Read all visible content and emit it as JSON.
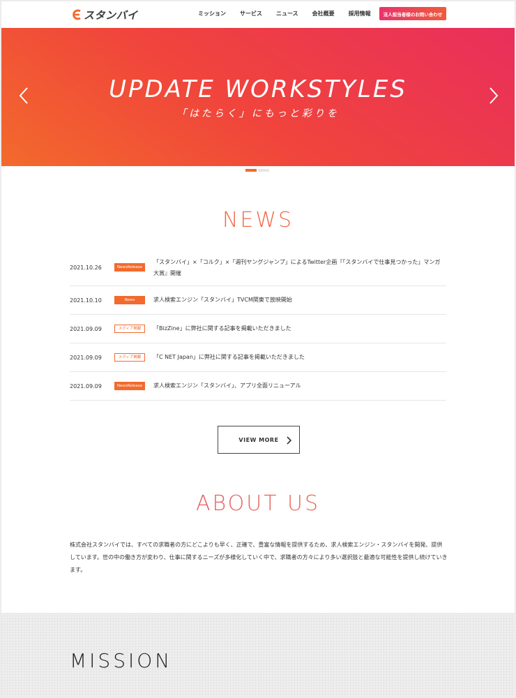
{
  "brand": {
    "logo_text": "スタンバイ",
    "accent": "#f36a2c",
    "accent2": "#e92f5c"
  },
  "nav": {
    "items": [
      {
        "label": "ミッション"
      },
      {
        "label": "サービス"
      },
      {
        "label": "ニュース"
      },
      {
        "label": "会社概要"
      },
      {
        "label": "採用情報"
      }
    ],
    "contact_label": "法人担当者様のお問い合わせ"
  },
  "hero": {
    "title": "UPDATE WORKSTYLES",
    "subtitle": "「はたらく」にもっと彩りを",
    "prev_icon": "chevron-left-icon",
    "next_icon": "chevron-right-icon",
    "slides_count": 2,
    "active_slide": 1
  },
  "news": {
    "title": "NEWS",
    "items": [
      {
        "date": "2021.10.26",
        "badge": "NewsRelease",
        "badge_style": "solid",
        "text": "「スタンバイ」×「コルク」×「週刊ヤングジャンプ」によるTwitter企画『「スタンバイで仕事見つかった」マンガ大賞』開催"
      },
      {
        "date": "2021.10.10",
        "badge": "News",
        "badge_style": "solid",
        "text": "求人検索エンジン「スタンバイ」TVCM関東で放映開始"
      },
      {
        "date": "2021.09.09",
        "badge": "メディア掲載",
        "badge_style": "outline",
        "text": "「BizZine」に弊社に関する記事を掲載いただきました"
      },
      {
        "date": "2021.09.09",
        "badge": "メディア掲載",
        "badge_style": "outline",
        "text": "「C NET Japan」に弊社に関する記事を掲載いただきました"
      },
      {
        "date": "2021.09.09",
        "badge": "NewsRelease",
        "badge_style": "solid",
        "text": "求人検索エンジン「スタンバイ」、アプリ全面リニューアル"
      }
    ],
    "view_more_label": "VIEW MORE"
  },
  "about": {
    "title": "ABOUT US",
    "body": "株式会社スタンバイでは、すべての求職者の方にどこよりも早く、正確で、豊富な情報を提供するため、求人検索エンジン・スタンバイを開発、提供しています。世の中の働き方が変わり、仕事に関するニーズが多様化していく中で、求職者の方々により多い選択肢と最適な可能性を提供し続けていきます。"
  },
  "mission": {
    "title": "MISSION"
  }
}
